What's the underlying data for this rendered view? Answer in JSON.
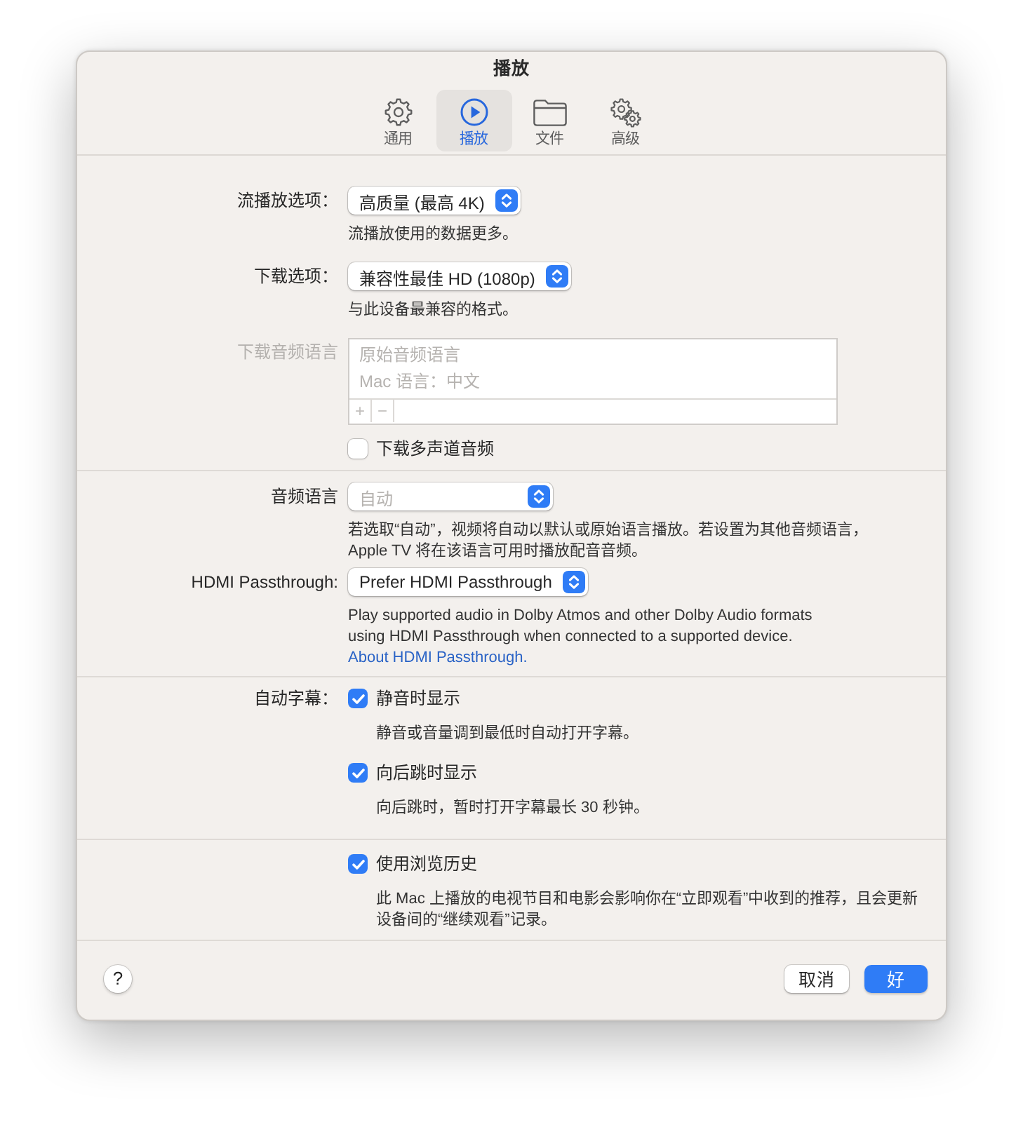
{
  "window": {
    "title": "播放"
  },
  "tabs": [
    {
      "label": "通用",
      "selected": false
    },
    {
      "label": "播放",
      "selected": true
    },
    {
      "label": "文件",
      "selected": false
    },
    {
      "label": "高级",
      "selected": false
    }
  ],
  "sections": [
    {
      "rows": [
        {
          "kind": "popup",
          "label": "流播放选项：",
          "value": "高质量 (最高 4K)",
          "note": "流播放使用的数据更多。",
          "disabled": false
        },
        {
          "kind": "popup",
          "label": "下载选项：",
          "value": "兼容性最佳 HD (1080p)",
          "note": "与此设备最兼容的格式。",
          "disabled": false
        },
        {
          "kind": "list",
          "label": "下载音频语言",
          "items": [
            "原始音频语言",
            "Mac 语言：中文"
          ],
          "add": "+",
          "remove": "−",
          "disabled": true
        },
        {
          "kind": "checkbox",
          "text": "下载多声道音频",
          "checked": false,
          "disabled": false
        }
      ]
    },
    {
      "rows": [
        {
          "kind": "popup",
          "label": "音频语言",
          "placeholder": "自动",
          "note": "若选取“自动”，视频将自动以默认或原始语言播放。若设置为其他音频语言，Apple TV 将在该语言可用时播放配音音频。",
          "disabled": false
        },
        {
          "kind": "popup",
          "label": "HDMI Passthrough:",
          "value": "Prefer HDMI Passthrough",
          "note": "Play supported audio in Dolby Atmos and other Dolby Audio formats using HDMI Passthrough when connected to a supported device.",
          "link": "About HDMI Passthrough.",
          "disabled": false
        }
      ]
    },
    {
      "rows": [
        {
          "kind": "checkbox",
          "label": "自动字幕：",
          "text": "静音时显示",
          "checked": true,
          "note": "静音或音量调到最低时自动打开字幕。",
          "disabled": false
        },
        {
          "kind": "checkbox",
          "text": "向后跳时显示",
          "checked": true,
          "note": "向后跳时，暂时打开字幕最长 30 秒钟。",
          "disabled": false
        }
      ]
    },
    {
      "rows": [
        {
          "kind": "checkbox",
          "text": "使用浏览历史",
          "checked": true,
          "note": "此 Mac 上播放的电视节目和电影会影响你在“立即观看”中收到的推荐，且会更新设备间的“继续观看”记录。",
          "disabled": false
        }
      ]
    }
  ],
  "footer": {
    "help": "?",
    "buttons": [
      {
        "label": "取消",
        "default": false
      },
      {
        "label": "好",
        "default": true
      }
    ]
  }
}
